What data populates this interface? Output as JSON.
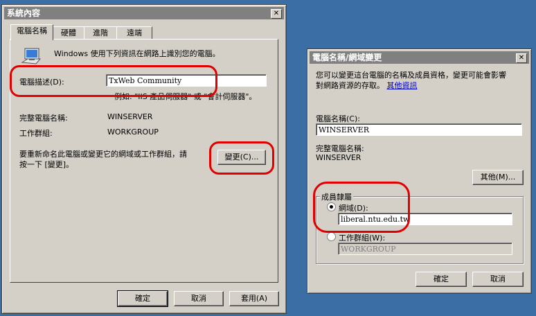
{
  "left": {
    "title": "系統內容",
    "close": "✕",
    "tabs": [
      "電腦名稱",
      "硬體",
      "進階",
      "遠端"
    ],
    "intro": "Windows 使用下列資訊在網路上識別您的電腦。",
    "desc_label": "電腦描述(D):",
    "desc_value": "TxWeb Community",
    "example": "例如: \"IIS 產品伺服器\" 或 \"會計伺服器\"。",
    "fullname_label": "完整電腦名稱:",
    "fullname_value": "WINSERVER",
    "workgroup_label": "工作群組:",
    "workgroup_value": "WORKGROUP",
    "rename_text_1": "要重新命名此電腦或變更它的網域或工作群組，請",
    "rename_text_2": "按一下 [變更]。",
    "change_button": "變更(C)...",
    "ok": "確定",
    "cancel": "取消",
    "apply": "套用(A)"
  },
  "right": {
    "title": "電腦名稱/網域變更",
    "close": "✕",
    "intro_1": "您可以變更這台電腦的名稱及成員資格，變更可能會影響",
    "intro_2": "對網路資源的存取。",
    "more_info": "其他資訊",
    "name_label": "電腦名稱(C):",
    "name_value": "WINSERVER",
    "fullname_label": "完整電腦名稱:",
    "fullname_value": "WINSERVER",
    "more_button": "其他(M)...",
    "member_of": "成員隸屬",
    "domain_label": "網域(D):",
    "domain_value": "liberal.ntu.edu.tw",
    "workgroup_label": "工作群組(W):",
    "workgroup_value": "WORKGROUP",
    "ok": "確定",
    "cancel": "取消"
  },
  "colors": {
    "desktop": "#3a6ea5",
    "dialog": "#d4d0c8",
    "highlight_circle": "#e00000"
  }
}
